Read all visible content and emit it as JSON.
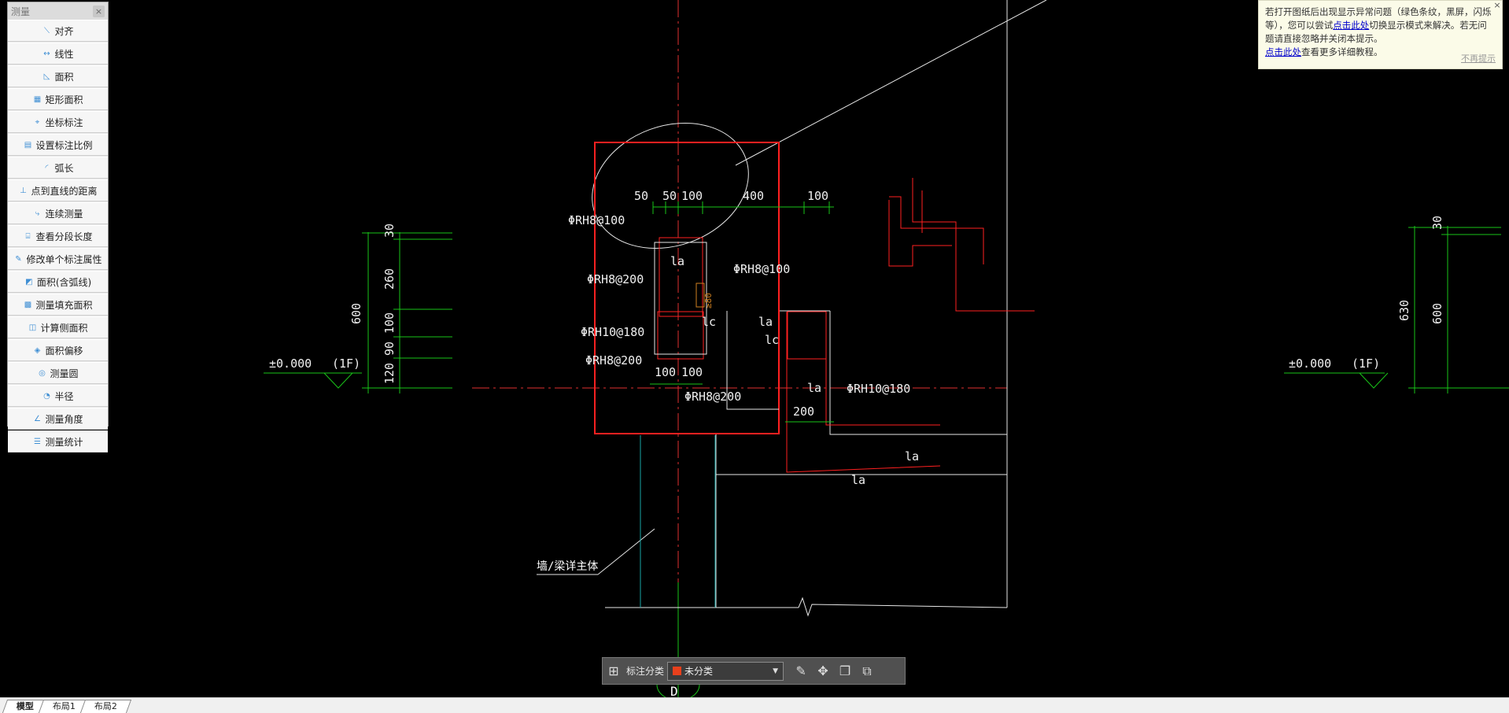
{
  "panel": {
    "title": "测量",
    "close": "×",
    "tools": [
      {
        "label": "对齐",
        "icon": "align-icon"
      },
      {
        "label": "线性",
        "icon": "linear-icon"
      },
      {
        "label": "面积",
        "icon": "area-icon"
      },
      {
        "label": "矩形面积",
        "icon": "rect-area-icon"
      },
      {
        "label": "坐标标注",
        "icon": "coordinate-icon"
      },
      {
        "label": "设置标注比例",
        "icon": "scale-icon"
      },
      {
        "label": "弧长",
        "icon": "arc-length-icon"
      },
      {
        "label": "点到直线的距离",
        "icon": "point-line-icon"
      },
      {
        "label": "连续测量",
        "icon": "continuous-icon"
      },
      {
        "label": "查看分段长度",
        "icon": "segment-icon"
      },
      {
        "label": "修改单个标注属性",
        "icon": "edit-dim-icon"
      },
      {
        "label": "面积(含弧线)",
        "icon": "arc-area-icon"
      },
      {
        "label": "测量填充面积",
        "icon": "fill-area-icon"
      },
      {
        "label": "计算侧面积",
        "icon": "side-area-icon"
      },
      {
        "label": "面积偏移",
        "icon": "area-offset-icon"
      },
      {
        "label": "测量圆",
        "icon": "circle-icon"
      },
      {
        "label": "半径",
        "icon": "radius-icon"
      },
      {
        "label": "测量角度",
        "icon": "angle-icon"
      },
      {
        "label": "测量统计",
        "icon": "stats-icon"
      }
    ]
  },
  "tip": {
    "line1a": "若打开图纸后出现显示异常问题（绿色条纹，黑屏，闪烁等），您可以尝试",
    "link1": "点击此处",
    "line1b": "切换显示模式来解决。若无问题请直接忽略并关闭本提示。",
    "link2": "点击此处",
    "line2": "查看更多详细教程。",
    "dismiss": "不再提示",
    "close": "×"
  },
  "toolbar": {
    "label": "标注分类",
    "selected": "未分类"
  },
  "tabs": [
    "模型",
    "布局1",
    "布局2"
  ],
  "drawing": {
    "dims_top": [
      "50",
      "50",
      "100",
      "400",
      "100"
    ],
    "dims_left": [
      "30",
      "260",
      "100",
      "90",
      "120",
      "600"
    ],
    "dims_right": [
      "30",
      "630",
      "600"
    ],
    "dim_bottom": [
      "100",
      "100",
      "200"
    ],
    "rebar": [
      "ΦRH8@100",
      "ΦRH8@200",
      "ΦRH10@180",
      "ΦRH8@200",
      "ΦRH8@200",
      "ΦRH8@100",
      "ΦRH10@180"
    ],
    "la": [
      "la",
      "lc",
      "la",
      "lc",
      "la",
      "la",
      "la"
    ],
    "elev_left": "±0.000",
    "floor_left": "(1F)",
    "elev_right": "±0.000",
    "floor_right": "(1F)",
    "wall_note": "墙/梁详主体",
    "side_dim": "≥80"
  }
}
